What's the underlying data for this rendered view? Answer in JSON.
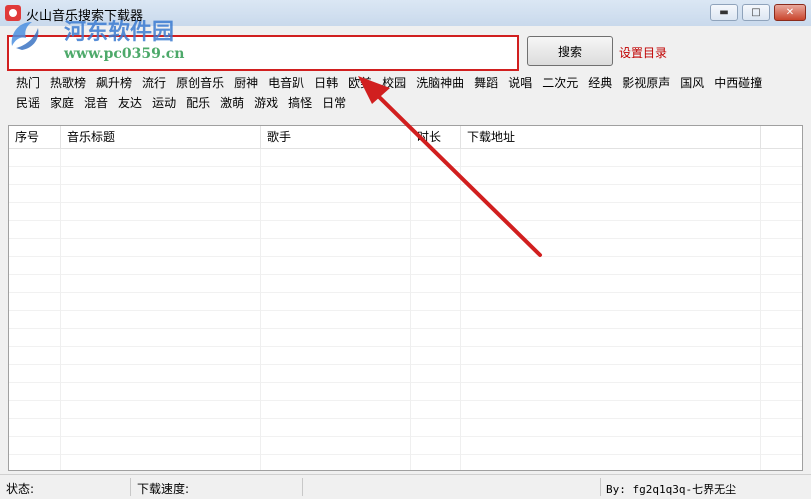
{
  "window": {
    "title": "火山音乐搜索下载器",
    "controls": {
      "minimize": "▬",
      "maximize": "□",
      "close": "✕"
    }
  },
  "watermark": {
    "title": "河东软件园",
    "url": "www.pc0359.cn"
  },
  "search": {
    "value": "",
    "placeholder": "",
    "button_label": "搜索",
    "settings_label": "设置目录"
  },
  "tags": {
    "row1": [
      "热门",
      "热歌榜",
      "飙升榜",
      "流行",
      "原创音乐",
      "厨神",
      "电音趴",
      "日韩",
      "欧美",
      "校园",
      "洗脑神曲",
      "舞蹈",
      "说唱",
      "二次元",
      "经典",
      "影视原声",
      "国风",
      "中西碰撞"
    ],
    "row2": [
      "民谣",
      "家庭",
      "混音",
      "友达",
      "运动",
      "配乐",
      "激萌",
      "游戏",
      "搞怪",
      "日常"
    ]
  },
  "table": {
    "columns": [
      "序号",
      "音乐标题",
      "歌手",
      "时长",
      "下载地址",
      ""
    ],
    "rows": []
  },
  "status": {
    "state_label": "状态:",
    "speed_label": "下载速度:",
    "credit": "By: fg2q1q3q-七界无尘"
  },
  "colors": {
    "highlight": "#d11f1f",
    "settings_link": "#c00000",
    "watermark_blue": "#3b7bd1",
    "watermark_green": "#3aa05a"
  },
  "icons": {
    "app": "app-icon",
    "minimize": "minimize-icon",
    "maximize": "maximize-icon",
    "close": "close-icon",
    "annotation": "red-arrow-annotation"
  }
}
